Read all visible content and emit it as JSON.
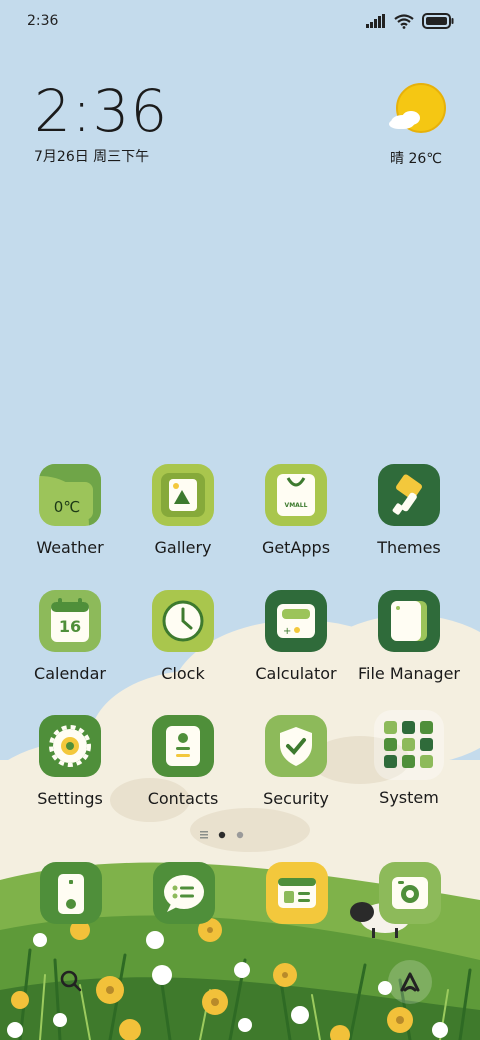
{
  "status_bar": {
    "time": "2:36"
  },
  "clock_widget": {
    "time": "2:36",
    "date": "7月26日 周三下午"
  },
  "weather_widget": {
    "text": "晴 26℃"
  },
  "apps": [
    {
      "label": "Weather",
      "icon": "weather-icon",
      "badge_text": "0℃"
    },
    {
      "label": "Gallery",
      "icon": "gallery-icon"
    },
    {
      "label": "GetApps",
      "icon": "getapps-icon",
      "badge_text": "VMALL"
    },
    {
      "label": "Themes",
      "icon": "themes-icon"
    },
    {
      "label": "Calendar",
      "icon": "calendar-icon",
      "badge_text": "16"
    },
    {
      "label": "Clock",
      "icon": "clock-icon"
    },
    {
      "label": "Calculator",
      "icon": "calculator-icon"
    },
    {
      "label": "File Manager",
      "icon": "file-manager-icon"
    },
    {
      "label": "Settings",
      "icon": "settings-icon"
    },
    {
      "label": "Contacts",
      "icon": "contacts-icon"
    },
    {
      "label": "Security",
      "icon": "security-icon"
    },
    {
      "label": "System",
      "icon": "system-folder-icon"
    }
  ],
  "dock": [
    {
      "icon": "phone-icon"
    },
    {
      "icon": "messages-icon"
    },
    {
      "icon": "browser-icon"
    },
    {
      "icon": "camera-icon"
    }
  ],
  "page_indicator": {
    "pages": 2,
    "current": 1
  },
  "colors": {
    "sky": "#C4DBEC",
    "icon_green": "#8DBA5A",
    "icon_dark_green": "#2F6B3A",
    "icon_yellow": "#F3C83C"
  }
}
